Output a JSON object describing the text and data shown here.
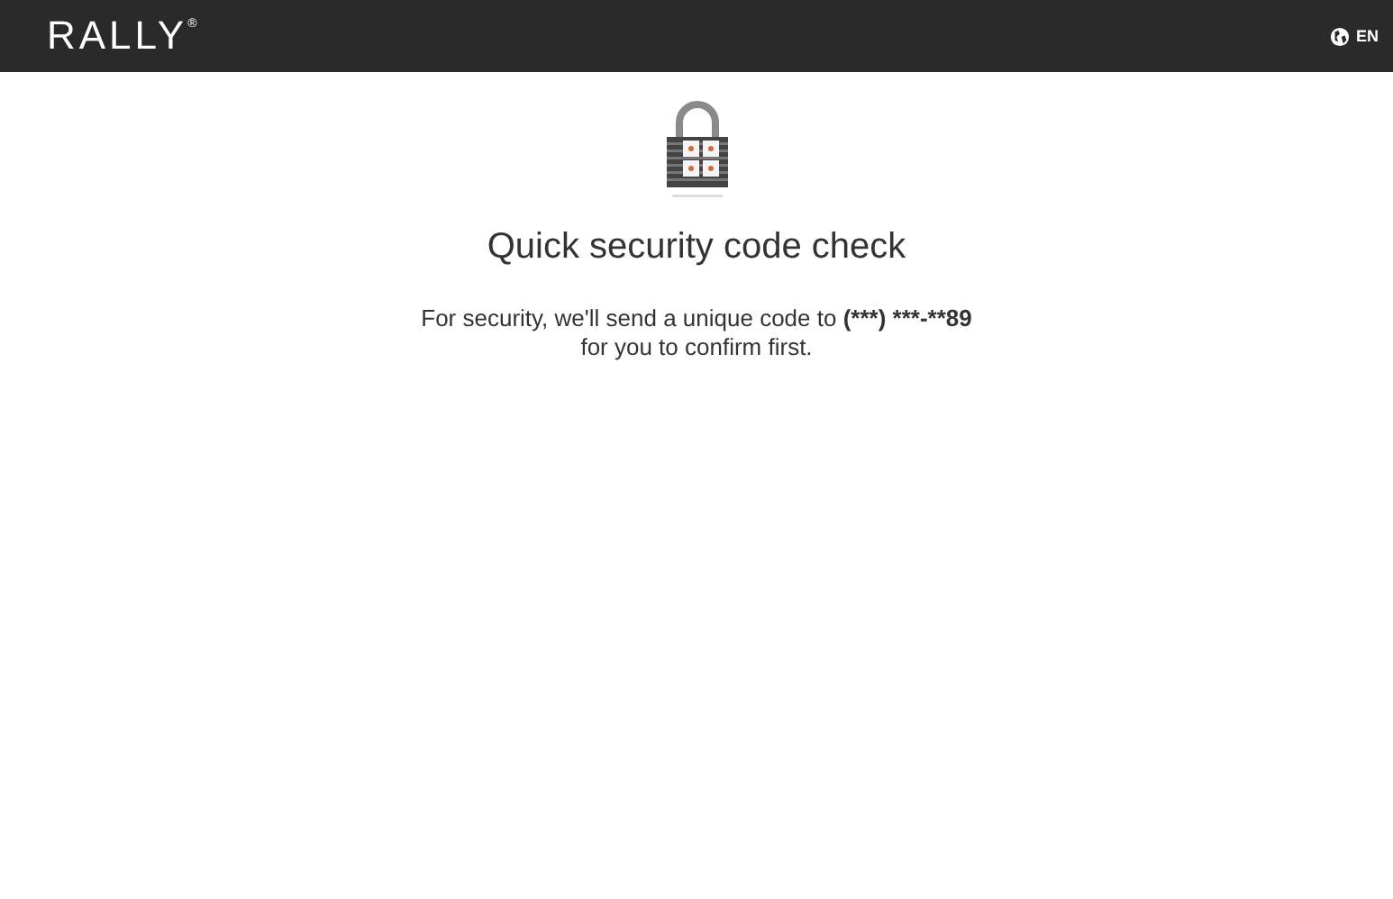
{
  "header": {
    "logo": "RALLY$^{®}$",
    "language": "EN"
  },
  "title": "Quick security code check",
  "message": [
    {
      "text": "For security, we'll send a unique code to ",
      "bold": false
    },
    {
      "text": "(***) ***-**89",
      "bold": true
    },
    {
      "text": "\nfor you to confirm first.",
      "bold": false
    }
  ]
}
